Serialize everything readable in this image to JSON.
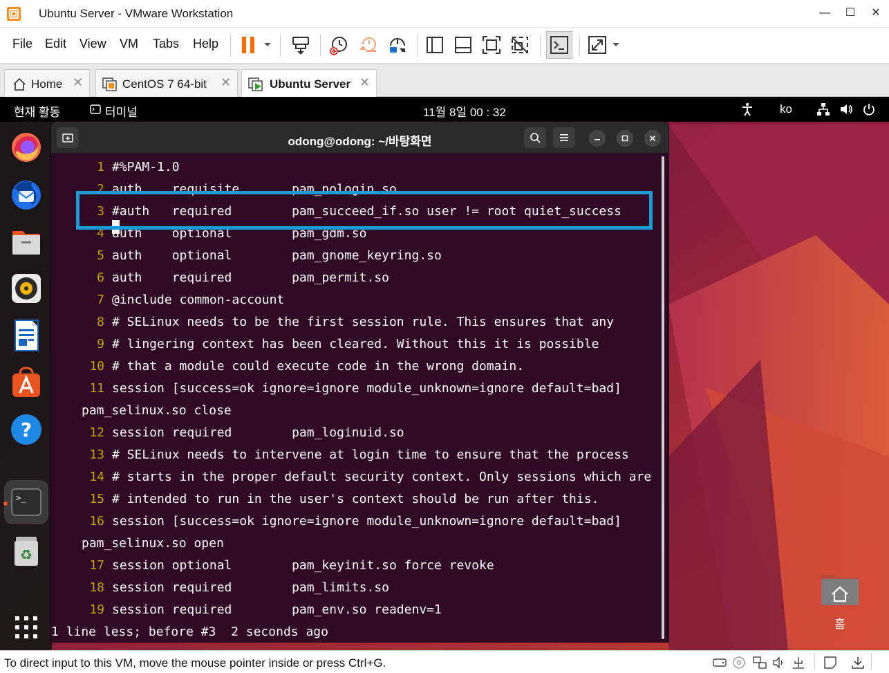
{
  "window": {
    "title": "Ubuntu Server - VMware Workstation",
    "minimize": "—",
    "maximize": "☐",
    "close": "✕"
  },
  "menu": [
    "File",
    "Edit",
    "View",
    "VM",
    "Tabs",
    "Help"
  ],
  "tabs": [
    {
      "label": "Home",
      "icon": "home-icon"
    },
    {
      "label": "CentOS 7 64-bit",
      "icon": "vm-icon"
    },
    {
      "label": "Ubuntu Server",
      "icon": "vm-running-icon",
      "active": true
    }
  ],
  "gnome": {
    "activities": "현재 활동",
    "app": "터미널",
    "clock": "11월 8일  00 : 32",
    "lang": "ko"
  },
  "terminal": {
    "title": "odong@odong: ~/바탕화면",
    "lines": [
      {
        "n": "1",
        "text": "#%PAM-1.0"
      },
      {
        "n": "2",
        "text": "auth    requisite       pam_nologin.so"
      },
      {
        "n": "3",
        "text": "#auth   required        pam_succeed_if.so user != root quiet_success"
      },
      {
        "n": "4",
        "text": "auth    optional        pam_gdm.so"
      },
      {
        "n": "5",
        "text": "auth    optional        pam_gnome_keyring.so"
      },
      {
        "n": "6",
        "text": "auth    required        pam_permit.so"
      },
      {
        "n": "7",
        "text": "@include common-account"
      },
      {
        "n": "8",
        "text": "# SELinux needs to be the first session rule. This ensures that any"
      },
      {
        "n": "9",
        "text": "# lingering context has been cleared. Without this it is possible"
      },
      {
        "n": "10",
        "text": "# that a module could execute code in the wrong domain."
      },
      {
        "n": "11",
        "text": "session [success=ok ignore=ignore module_unknown=ignore default=bad]"
      },
      {
        "n": "",
        "text": "pam_selinux.so close",
        "wrap": true
      },
      {
        "n": "12",
        "text": "session required        pam_loginuid.so"
      },
      {
        "n": "13",
        "text": "# SELinux needs to intervene at login time to ensure that the process"
      },
      {
        "n": "14",
        "text": "# starts in the proper default security context. Only sessions which are"
      },
      {
        "n": "15",
        "text": "# intended to run in the user's context should be run after this."
      },
      {
        "n": "16",
        "text": "session [success=ok ignore=ignore module_unknown=ignore default=bad]"
      },
      {
        "n": "",
        "text": "pam_selinux.so open",
        "wrap": true
      },
      {
        "n": "17",
        "text": "session optional        pam_keyinit.so force revoke"
      },
      {
        "n": "18",
        "text": "session required        pam_limits.so"
      },
      {
        "n": "19",
        "text": "session required        pam_env.so readenv=1"
      }
    ],
    "status": "1 line less; before #3  2 seconds ago"
  },
  "desktop": {
    "home_label": "홈"
  },
  "statusbar": {
    "text": "To direct input to this VM, move the mouse pointer inside or press Ctrl+G."
  },
  "colors": {
    "terminal_bg": "#300a24",
    "line_number": "#c4a000",
    "highlight": "#1a9bd7",
    "pause_orange": "#ff6a00",
    "ubuntu_orange": "#e95420"
  }
}
